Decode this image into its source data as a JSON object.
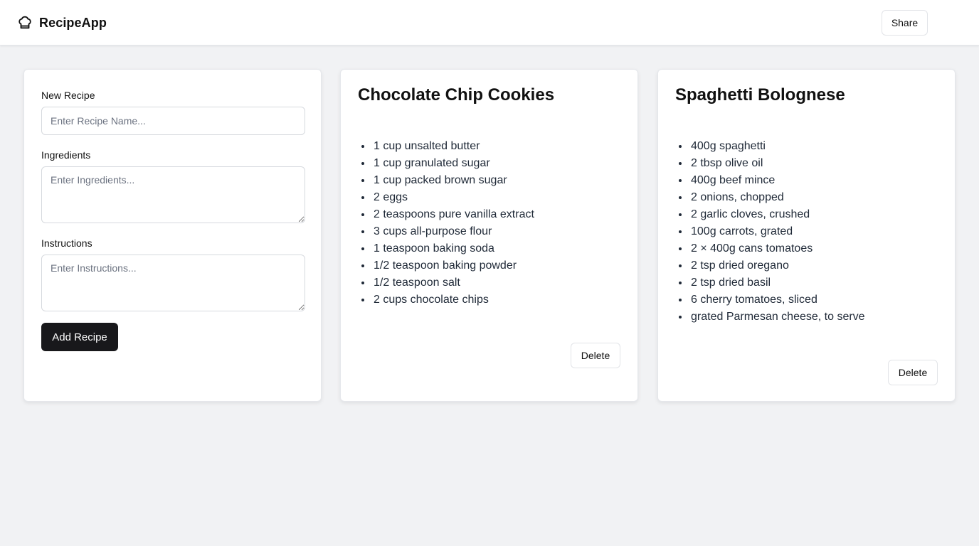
{
  "app": {
    "name": "RecipeApp",
    "logo_icon": "chef-hat-icon"
  },
  "header": {
    "share_label": "Share"
  },
  "form": {
    "name_label": "New Recipe",
    "name_placeholder": "Enter Recipe Name...",
    "name_value": "",
    "ingredients_label": "Ingredients",
    "ingredients_placeholder": "Enter Ingredients...",
    "ingredients_value": "",
    "instructions_label": "Instructions",
    "instructions_placeholder": "Enter Instructions...",
    "instructions_value": "",
    "submit_label": "Add Recipe"
  },
  "recipes": [
    {
      "title": "Chocolate Chip Cookies",
      "ingredients": [
        "1 cup unsalted butter",
        "1 cup granulated sugar",
        "1 cup packed brown sugar",
        "2 eggs",
        "2 teaspoons pure vanilla extract",
        "3 cups all-purpose flour",
        "1 teaspoon baking soda",
        "1/2 teaspoon baking powder",
        "1/2 teaspoon salt",
        "2 cups chocolate chips"
      ],
      "delete_label": "Delete"
    },
    {
      "title": "Spaghetti Bolognese",
      "ingredients": [
        "400g spaghetti",
        "2 tbsp olive oil",
        "400g beef mince",
        "2 onions, chopped",
        "2 garlic cloves, crushed",
        "100g carrots, grated",
        "2 × 400g cans tomatoes",
        "2 tsp dried oregano",
        "2 tsp dried basil",
        "6 cherry tomatoes, sliced",
        "grated Parmesan cheese, to serve"
      ],
      "delete_label": "Delete"
    }
  ],
  "colors": {
    "page_background": "#f1f2f4",
    "primary_button": "#18181b",
    "primary_button_text": "#ffffff"
  }
}
